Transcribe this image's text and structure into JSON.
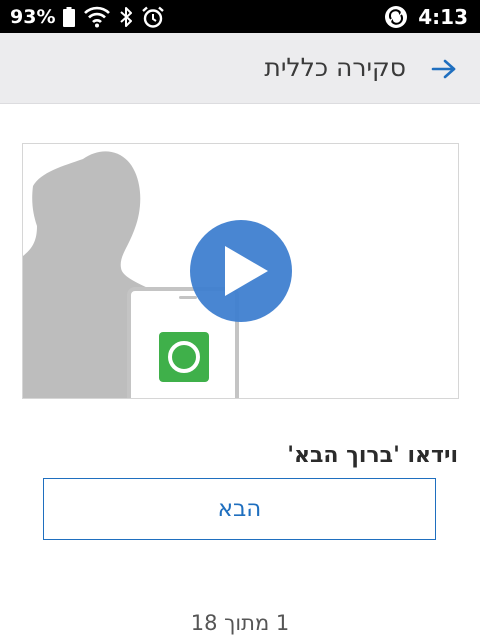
{
  "status_bar": {
    "battery_percent": "93%",
    "time": "4:13",
    "icons": [
      "battery-icon",
      "wifi-icon",
      "bluetooth-icon",
      "alarm-icon",
      "sync-icon"
    ]
  },
  "header": {
    "title": "סקירה כללית",
    "back_icon": "arrow-right-icon"
  },
  "video": {
    "play_icon": "play-icon",
    "caption": "וידאו 'ברוך הבא'"
  },
  "next_button": {
    "label": "הבא"
  },
  "page_indicator": {
    "text": "1 מתוך 18"
  },
  "colors": {
    "accent": "#1f6fbf",
    "play_button": "#3f7fd0",
    "app_icon": "#3fb04a",
    "silhouette": "#bdbdbd"
  }
}
